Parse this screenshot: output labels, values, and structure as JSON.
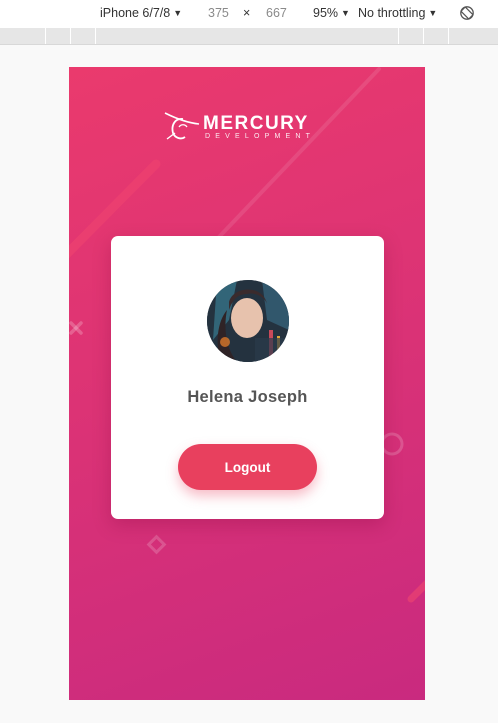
{
  "devtools": {
    "device": "iPhone 6/7/8",
    "width": "375",
    "times": "×",
    "height": "667",
    "zoom": "95%",
    "throttling": "No throttling",
    "rotate_icon": "rotate-icon"
  },
  "app": {
    "logo": {
      "name": "MERCURY",
      "tagline": "DEVELOPMENT"
    },
    "profile": {
      "name": "Helena Joseph",
      "logout_label": "Logout"
    },
    "colors": {
      "gradient_start": "#ea3a6d",
      "gradient_end": "#c92a7f",
      "button": "#e8405e",
      "name_text": "#555555"
    }
  }
}
